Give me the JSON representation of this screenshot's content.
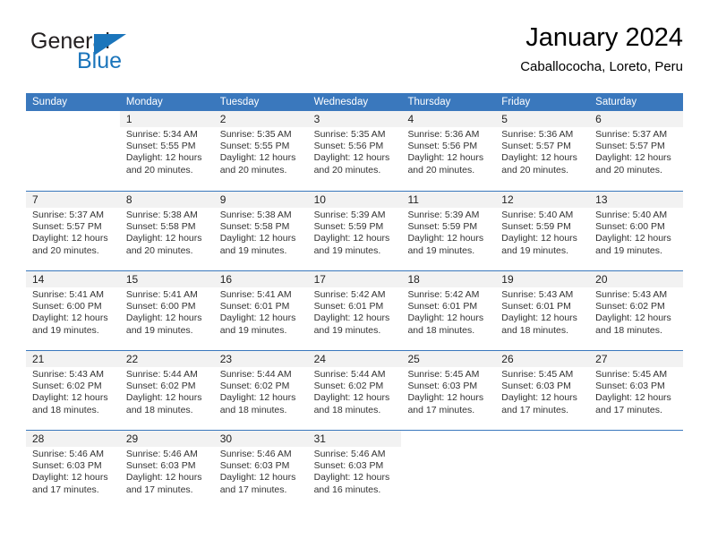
{
  "brand": {
    "name_part1": "General",
    "name_part2": "Blue",
    "logo_icon": "triangle-icon",
    "accent_color": "#1b75bb"
  },
  "header": {
    "title": "January 2024",
    "subtitle": "Caballococha, Loreto, Peru"
  },
  "calendar": {
    "header_bg_color": "#3a78bd",
    "daynum_bg_color": "#f2f2f2",
    "weekdays": [
      "Sunday",
      "Monday",
      "Tuesday",
      "Wednesday",
      "Thursday",
      "Friday",
      "Saturday"
    ],
    "weeks": [
      [
        {
          "day": "",
          "sunrise": "",
          "sunset": "",
          "daylight_line1": "",
          "daylight_line2": "",
          "empty": true
        },
        {
          "day": "1",
          "sunrise": "Sunrise: 5:34 AM",
          "sunset": "Sunset: 5:55 PM",
          "daylight_line1": "Daylight: 12 hours",
          "daylight_line2": "and 20 minutes."
        },
        {
          "day": "2",
          "sunrise": "Sunrise: 5:35 AM",
          "sunset": "Sunset: 5:55 PM",
          "daylight_line1": "Daylight: 12 hours",
          "daylight_line2": "and 20 minutes."
        },
        {
          "day": "3",
          "sunrise": "Sunrise: 5:35 AM",
          "sunset": "Sunset: 5:56 PM",
          "daylight_line1": "Daylight: 12 hours",
          "daylight_line2": "and 20 minutes."
        },
        {
          "day": "4",
          "sunrise": "Sunrise: 5:36 AM",
          "sunset": "Sunset: 5:56 PM",
          "daylight_line1": "Daylight: 12 hours",
          "daylight_line2": "and 20 minutes."
        },
        {
          "day": "5",
          "sunrise": "Sunrise: 5:36 AM",
          "sunset": "Sunset: 5:57 PM",
          "daylight_line1": "Daylight: 12 hours",
          "daylight_line2": "and 20 minutes."
        },
        {
          "day": "6",
          "sunrise": "Sunrise: 5:37 AM",
          "sunset": "Sunset: 5:57 PM",
          "daylight_line1": "Daylight: 12 hours",
          "daylight_line2": "and 20 minutes."
        }
      ],
      [
        {
          "day": "7",
          "sunrise": "Sunrise: 5:37 AM",
          "sunset": "Sunset: 5:57 PM",
          "daylight_line1": "Daylight: 12 hours",
          "daylight_line2": "and 20 minutes."
        },
        {
          "day": "8",
          "sunrise": "Sunrise: 5:38 AM",
          "sunset": "Sunset: 5:58 PM",
          "daylight_line1": "Daylight: 12 hours",
          "daylight_line2": "and 20 minutes."
        },
        {
          "day": "9",
          "sunrise": "Sunrise: 5:38 AM",
          "sunset": "Sunset: 5:58 PM",
          "daylight_line1": "Daylight: 12 hours",
          "daylight_line2": "and 19 minutes."
        },
        {
          "day": "10",
          "sunrise": "Sunrise: 5:39 AM",
          "sunset": "Sunset: 5:59 PM",
          "daylight_line1": "Daylight: 12 hours",
          "daylight_line2": "and 19 minutes."
        },
        {
          "day": "11",
          "sunrise": "Sunrise: 5:39 AM",
          "sunset": "Sunset: 5:59 PM",
          "daylight_line1": "Daylight: 12 hours",
          "daylight_line2": "and 19 minutes."
        },
        {
          "day": "12",
          "sunrise": "Sunrise: 5:40 AM",
          "sunset": "Sunset: 5:59 PM",
          "daylight_line1": "Daylight: 12 hours",
          "daylight_line2": "and 19 minutes."
        },
        {
          "day": "13",
          "sunrise": "Sunrise: 5:40 AM",
          "sunset": "Sunset: 6:00 PM",
          "daylight_line1": "Daylight: 12 hours",
          "daylight_line2": "and 19 minutes."
        }
      ],
      [
        {
          "day": "14",
          "sunrise": "Sunrise: 5:41 AM",
          "sunset": "Sunset: 6:00 PM",
          "daylight_line1": "Daylight: 12 hours",
          "daylight_line2": "and 19 minutes."
        },
        {
          "day": "15",
          "sunrise": "Sunrise: 5:41 AM",
          "sunset": "Sunset: 6:00 PM",
          "daylight_line1": "Daylight: 12 hours",
          "daylight_line2": "and 19 minutes."
        },
        {
          "day": "16",
          "sunrise": "Sunrise: 5:41 AM",
          "sunset": "Sunset: 6:01 PM",
          "daylight_line1": "Daylight: 12 hours",
          "daylight_line2": "and 19 minutes."
        },
        {
          "day": "17",
          "sunrise": "Sunrise: 5:42 AM",
          "sunset": "Sunset: 6:01 PM",
          "daylight_line1": "Daylight: 12 hours",
          "daylight_line2": "and 19 minutes."
        },
        {
          "day": "18",
          "sunrise": "Sunrise: 5:42 AM",
          "sunset": "Sunset: 6:01 PM",
          "daylight_line1": "Daylight: 12 hours",
          "daylight_line2": "and 18 minutes."
        },
        {
          "day": "19",
          "sunrise": "Sunrise: 5:43 AM",
          "sunset": "Sunset: 6:01 PM",
          "daylight_line1": "Daylight: 12 hours",
          "daylight_line2": "and 18 minutes."
        },
        {
          "day": "20",
          "sunrise": "Sunrise: 5:43 AM",
          "sunset": "Sunset: 6:02 PM",
          "daylight_line1": "Daylight: 12 hours",
          "daylight_line2": "and 18 minutes."
        }
      ],
      [
        {
          "day": "21",
          "sunrise": "Sunrise: 5:43 AM",
          "sunset": "Sunset: 6:02 PM",
          "daylight_line1": "Daylight: 12 hours",
          "daylight_line2": "and 18 minutes."
        },
        {
          "day": "22",
          "sunrise": "Sunrise: 5:44 AM",
          "sunset": "Sunset: 6:02 PM",
          "daylight_line1": "Daylight: 12 hours",
          "daylight_line2": "and 18 minutes."
        },
        {
          "day": "23",
          "sunrise": "Sunrise: 5:44 AM",
          "sunset": "Sunset: 6:02 PM",
          "daylight_line1": "Daylight: 12 hours",
          "daylight_line2": "and 18 minutes."
        },
        {
          "day": "24",
          "sunrise": "Sunrise: 5:44 AM",
          "sunset": "Sunset: 6:02 PM",
          "daylight_line1": "Daylight: 12 hours",
          "daylight_line2": "and 18 minutes."
        },
        {
          "day": "25",
          "sunrise": "Sunrise: 5:45 AM",
          "sunset": "Sunset: 6:03 PM",
          "daylight_line1": "Daylight: 12 hours",
          "daylight_line2": "and 17 minutes."
        },
        {
          "day": "26",
          "sunrise": "Sunrise: 5:45 AM",
          "sunset": "Sunset: 6:03 PM",
          "daylight_line1": "Daylight: 12 hours",
          "daylight_line2": "and 17 minutes."
        },
        {
          "day": "27",
          "sunrise": "Sunrise: 5:45 AM",
          "sunset": "Sunset: 6:03 PM",
          "daylight_line1": "Daylight: 12 hours",
          "daylight_line2": "and 17 minutes."
        }
      ],
      [
        {
          "day": "28",
          "sunrise": "Sunrise: 5:46 AM",
          "sunset": "Sunset: 6:03 PM",
          "daylight_line1": "Daylight: 12 hours",
          "daylight_line2": "and 17 minutes."
        },
        {
          "day": "29",
          "sunrise": "Sunrise: 5:46 AM",
          "sunset": "Sunset: 6:03 PM",
          "daylight_line1": "Daylight: 12 hours",
          "daylight_line2": "and 17 minutes."
        },
        {
          "day": "30",
          "sunrise": "Sunrise: 5:46 AM",
          "sunset": "Sunset: 6:03 PM",
          "daylight_line1": "Daylight: 12 hours",
          "daylight_line2": "and 17 minutes."
        },
        {
          "day": "31",
          "sunrise": "Sunrise: 5:46 AM",
          "sunset": "Sunset: 6:03 PM",
          "daylight_line1": "Daylight: 12 hours",
          "daylight_line2": "and 16 minutes."
        },
        {
          "day": "",
          "sunrise": "",
          "sunset": "",
          "daylight_line1": "",
          "daylight_line2": "",
          "empty": true
        },
        {
          "day": "",
          "sunrise": "",
          "sunset": "",
          "daylight_line1": "",
          "daylight_line2": "",
          "empty": true
        },
        {
          "day": "",
          "sunrise": "",
          "sunset": "",
          "daylight_line1": "",
          "daylight_line2": "",
          "empty": true
        }
      ]
    ]
  }
}
